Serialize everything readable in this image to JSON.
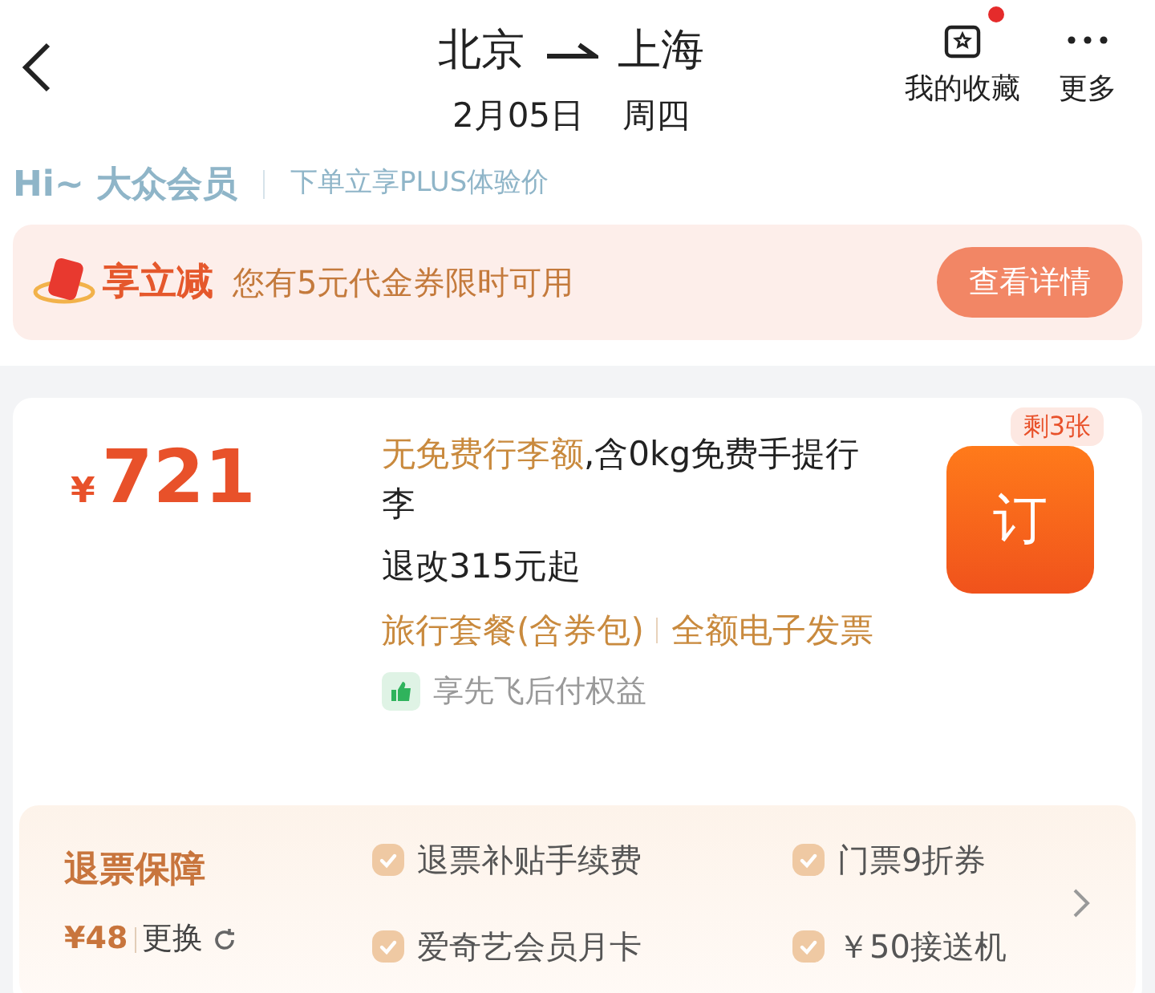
{
  "header": {
    "from": "北京",
    "to": "上海",
    "date": "2月05日",
    "weekday": "周四",
    "actions": [
      {
        "kind": "favorite",
        "label": "我的收藏",
        "badge": true
      },
      {
        "kind": "more",
        "label": "更多",
        "badge": false
      }
    ]
  },
  "member": {
    "greeting": "Hi~ 大众会员",
    "promo": "下单立享PLUS体验价"
  },
  "coupon": {
    "title": "享立减",
    "text": "您有5元代金券限时可用",
    "button": "查看详情"
  },
  "offer": {
    "currency": "¥",
    "price": "721",
    "baggage_highlight": "无免费行李额",
    "baggage_rest": ",含0kg免费手提行李",
    "refund": "退改315元起",
    "tags": [
      "旅行套餐(含券包)",
      "全额电子发票"
    ],
    "perk": "享先飞后付权益",
    "book_button": "订",
    "remaining": "剩3张"
  },
  "protection": {
    "title": "退票保障",
    "price": "¥48",
    "change": "更换",
    "benefits": [
      "退票补贴手续费",
      "门票9折券",
      "爱奇艺会员月卡",
      "￥50接送机"
    ]
  }
}
